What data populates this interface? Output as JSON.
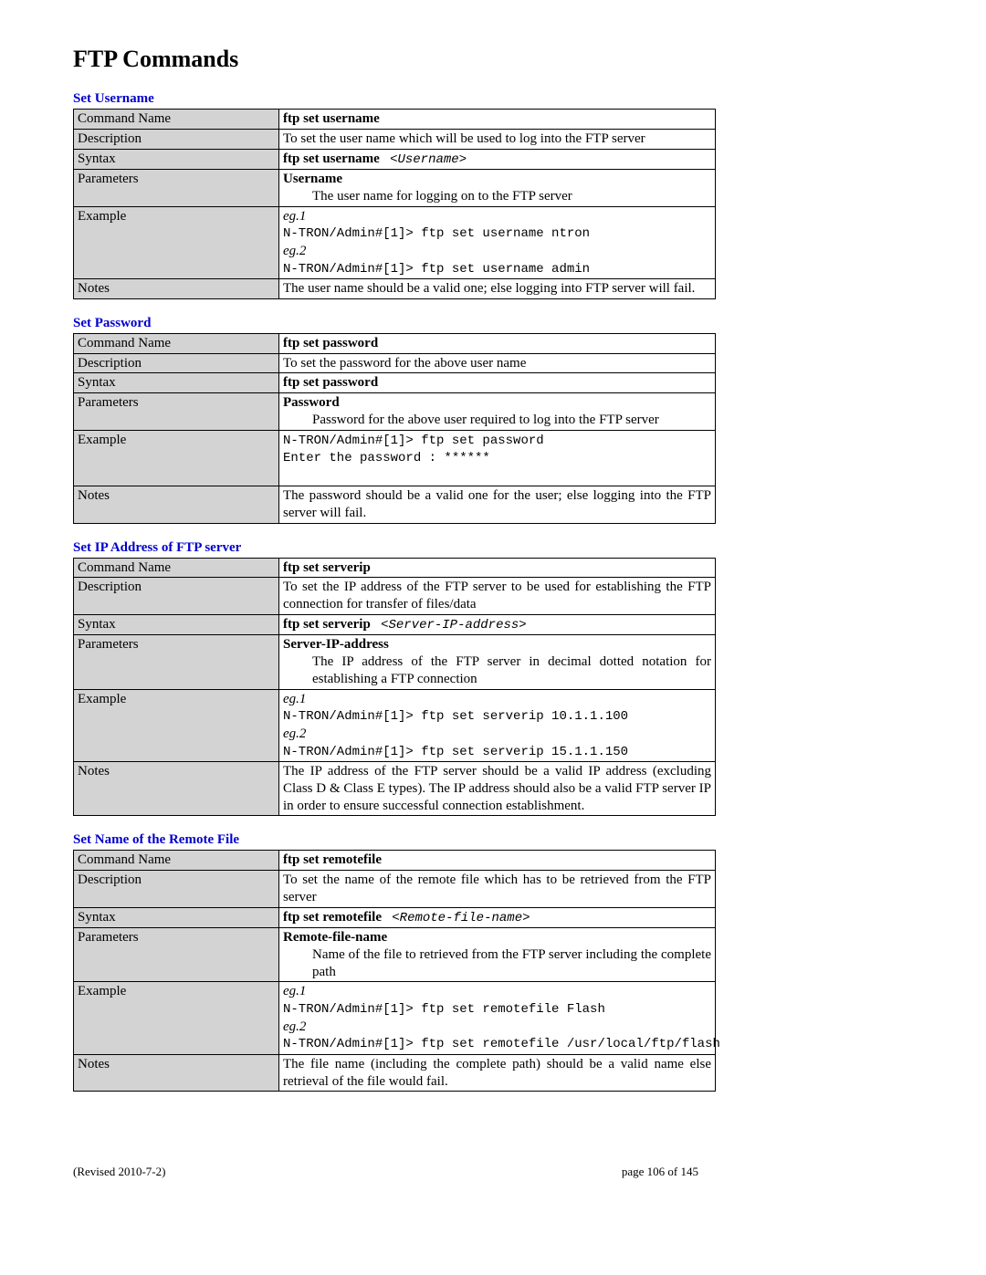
{
  "page_title": "FTP Commands",
  "labels": {
    "command_name": "Command Name",
    "description": "Description",
    "syntax": "Syntax",
    "parameters": "Parameters",
    "example": "Example",
    "notes": "Notes"
  },
  "sections": {
    "set_username": {
      "title": "Set Username",
      "command_name": "ftp set username",
      "description": "To set the user name which will be used to log into the FTP server",
      "syntax_cmd": "ftp set username",
      "syntax_arg": "<Username>",
      "param_name": "Username",
      "param_desc": "The user name for logging on to the FTP server",
      "eg1_label": "eg.1",
      "eg1_code": "N-TRON/Admin#[1]> ftp set username ntron",
      "eg2_label": "eg.2",
      "eg2_code": "N-TRON/Admin#[1]> ftp set username admin",
      "notes": "The user name should be a valid one; else logging into FTP server will fail."
    },
    "set_password": {
      "title": "Set Password",
      "command_name": "ftp set password",
      "description": "To set the password for the above user name",
      "syntax_cmd": "ftp set password",
      "param_name": "Password",
      "param_desc": "Password for the above user required to log into the FTP server",
      "example_code": "N-TRON/Admin#[1]> ftp set password\nEnter the password : ******\n ",
      "notes": "The password should be a valid one for the user; else logging into the FTP server will fail."
    },
    "set_serverip": {
      "title": "Set IP Address of FTP server",
      "command_name": "ftp set serverip",
      "description": "To set the IP address of the FTP server to be used for establishing the FTP connection for transfer of files/data",
      "syntax_cmd": "ftp set serverip",
      "syntax_arg": "<Server-IP-address>",
      "param_name": "Server-IP-address",
      "param_desc": "The IP address of the FTP server in decimal dotted notation for establishing a FTP connection",
      "eg1_label": "eg.1",
      "eg1_code": "N-TRON/Admin#[1]> ftp set serverip 10.1.1.100",
      "eg2_label": "eg.2",
      "eg2_code": "N-TRON/Admin#[1]> ftp set serverip 15.1.1.150",
      "notes": "The IP address of the FTP server should be a valid IP address (excluding Class D & Class E types). The IP address should also be a valid FTP server IP in order to ensure successful connection establishment."
    },
    "set_remotefile": {
      "title": "Set Name of the Remote File",
      "command_name": "ftp set remotefile",
      "description": "To set the name of the remote file which has to be retrieved from the FTP server",
      "syntax_cmd": "ftp set remotefile",
      "syntax_arg": "<Remote-file-name>",
      "param_name": "Remote-file-name",
      "param_desc": "Name of the file to retrieved from the FTP server including the complete path",
      "eg1_label": "eg.1",
      "eg1_code": "N-TRON/Admin#[1]> ftp set remotefile Flash",
      "eg2_label": "eg.2",
      "eg2_code": "N-TRON/Admin#[1]> ftp set remotefile /usr/local/ftp/flash",
      "notes": "The file name (including the complete path) should be a valid name else retrieval of the file would fail."
    }
  },
  "footer": {
    "revised": "(Revised 2010-7-2)",
    "page": "page 106 of 145"
  }
}
